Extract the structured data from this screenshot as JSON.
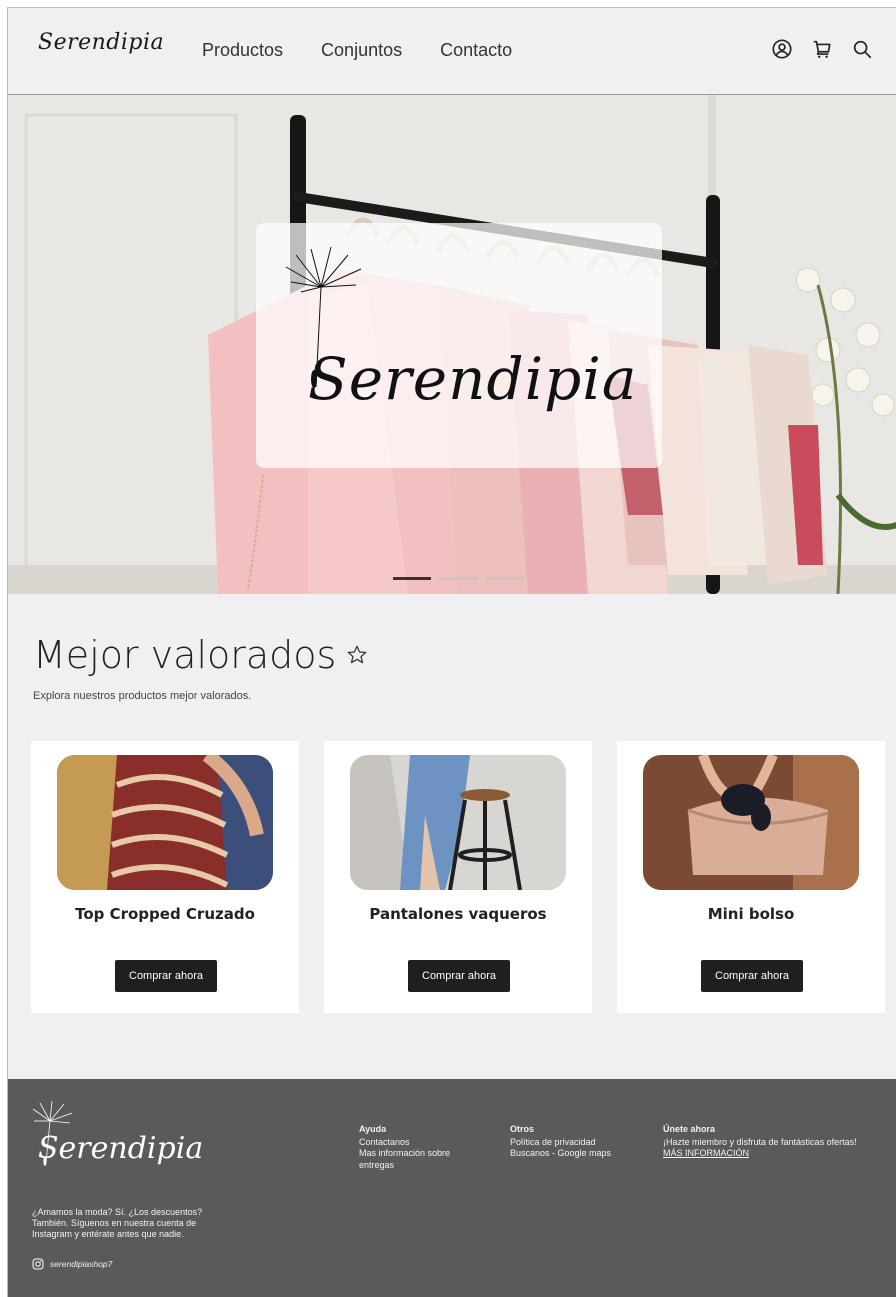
{
  "header": {
    "logo": "Serendipia",
    "nav": [
      "Productos",
      "Conjuntos",
      "Contacto"
    ],
    "icons": [
      "user-icon",
      "cart-icon",
      "search-icon"
    ]
  },
  "hero": {
    "logo": "Serendipia",
    "slides_total": 3,
    "active_slide": 1
  },
  "best_rated": {
    "title": "Mejor valorados",
    "subtitle": "Explora nuestros productos mejor valorados.",
    "products": [
      {
        "name": "Top Cropped Cruzado",
        "button": "Comprar ahora"
      },
      {
        "name": "Pantalones vaqueros",
        "button": "Comprar ahora"
      },
      {
        "name": "Mini bolso",
        "button": "Comprar ahora"
      }
    ]
  },
  "footer": {
    "logo": "Serendipia",
    "about": "¿Amamos la moda? Sí. ¿Los descuentos? También. Síguenos en nuestra cuenta de Instagram  y entérate antes que nadie.",
    "instagram": "serendipiashop7",
    "columns": [
      {
        "heading": "Ayuda",
        "links": [
          "Contactanos",
          "Mas información sobre entregas"
        ]
      },
      {
        "heading": "Otros",
        "links": [
          "Política de privacidad",
          "Buscanos - Google maps"
        ]
      },
      {
        "heading": "Únete ahora",
        "text": "¡Hazte miembro y disfruta de fantásticas ofertas!",
        "link": "MÁS INFORMACIÓN"
      }
    ]
  },
  "colors": {
    "background": "#f0f0f2",
    "footer": "#5a5a5a",
    "button": "#1f1f22"
  }
}
